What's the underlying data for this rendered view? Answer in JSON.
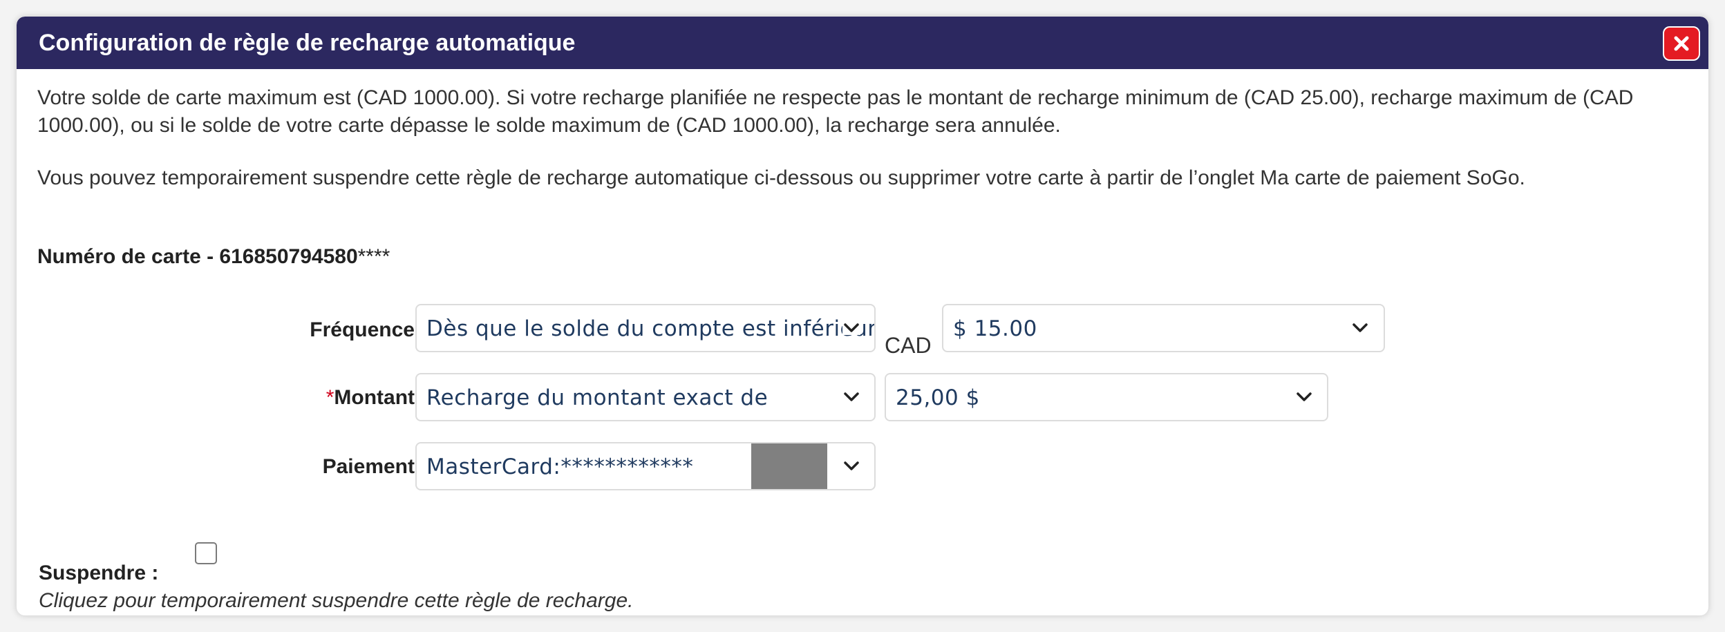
{
  "dialog": {
    "title": "Configuration de règle de recharge automatique",
    "close_icon": "close-icon",
    "colors": {
      "titlebar": "#2c2860",
      "close_button": "#e41b23"
    }
  },
  "body": {
    "paragraph1": "Votre solde de carte maximum est (CAD 1000.00). Si votre recharge planifiée ne respecte pas le montant de recharge minimum de (CAD 25.00), recharge maximum de (CAD 1000.00), ou si le solde de votre carte dépasse le solde maximum de (CAD 1000.00), la recharge sera annulée.",
    "paragraph2": "Vous pouvez temporairement suspendre cette règle de recharge automatique ci-dessous ou supprimer votre carte à partir de l’onglet Ma carte de paiement SoGo.",
    "card_number_label": "Numéro de carte - 616850794580",
    "card_number_mask": "****"
  },
  "form": {
    "frequency_label": "Fréquence:",
    "frequency_value": "Dès que le solde du compte est inférieur à",
    "currency_label": "CAD",
    "threshold_value": "$ 15.00",
    "amount_required_marker": "*",
    "amount_label": "Montant:",
    "amount_type_value": "Recharge du montant exact de",
    "amount_value": "25,00 $",
    "payment_label": "Paiement:",
    "payment_value": "MasterCard:************",
    "suspend_label": "Suspendre :",
    "suspend_checked": false,
    "suspend_hint": "Cliquez pour temporairement suspendre cette règle de recharge."
  }
}
